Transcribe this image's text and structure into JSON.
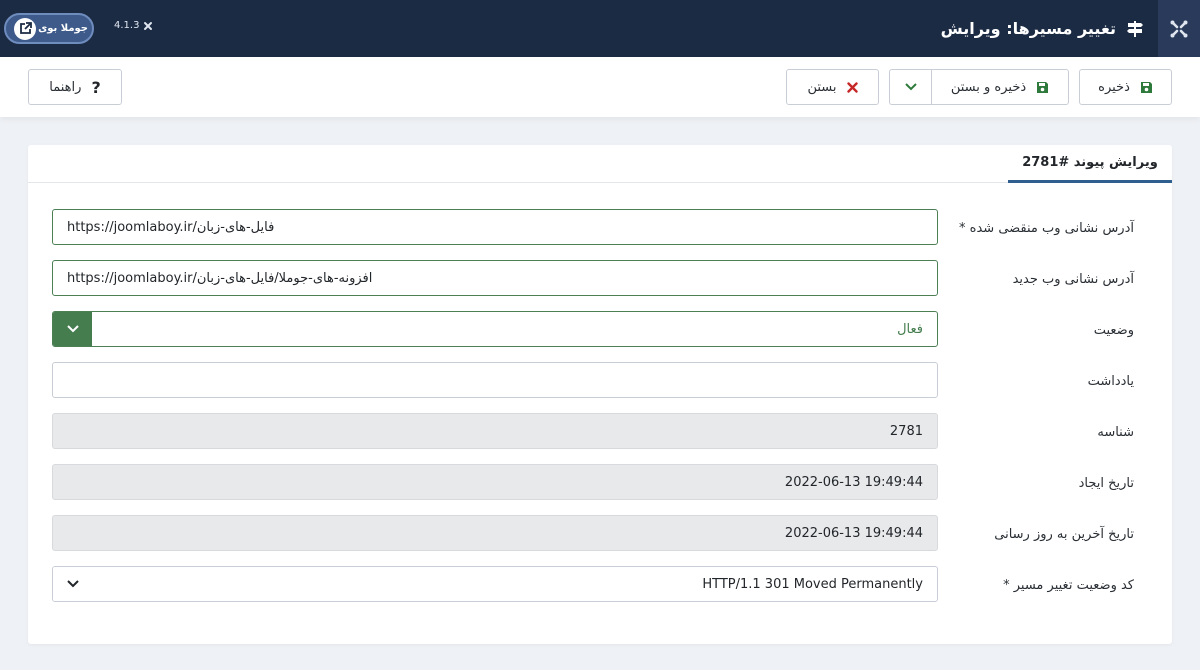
{
  "header": {
    "title": "تغییر مسیرها: ویرایش",
    "site_button": "جوملا بوی",
    "version": "4.1.3"
  },
  "toolbar": {
    "save_label": "ذخیره",
    "save_close_label": "ذخیره و بستن",
    "close_label": "بستن",
    "help_label": "راهنما"
  },
  "tab": {
    "label": "ویرایش پیوند #2781"
  },
  "form": {
    "old_url": {
      "label": "آدرس نشانی وب منقضی شده *",
      "value": "https://joomlaboy.ir/فایل-های-زبان"
    },
    "new_url": {
      "label": "آدرس نشانی وب جدید",
      "value": "https://joomlaboy.ir/افزونه-های-جوملا/فایل-های-زبان"
    },
    "status": {
      "label": "وضعیت",
      "value": "فعال"
    },
    "comment": {
      "label": "یادداشت",
      "value": ""
    },
    "id": {
      "label": "شناسه",
      "value": "2781"
    },
    "created": {
      "label": "تاریخ ایجاد",
      "value": "2022-06-13 19:49:44"
    },
    "modified": {
      "label": "تاریخ آخرین به روز رسانی",
      "value": "2022-06-13 19:49:44"
    },
    "header": {
      "label": "کد وضعیت تغییر مسیر *",
      "value": "HTTP/1.1 301 Moved Permanently"
    }
  },
  "colors": {
    "header_bg": "#1c2b44",
    "valid_green": "#457d4f",
    "save_icon_green": "#2e7a3c",
    "close_icon_red": "#c52827",
    "tab_underline": "#2f5f8f"
  }
}
